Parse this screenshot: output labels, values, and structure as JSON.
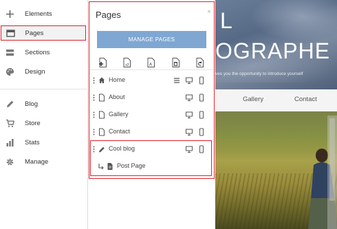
{
  "sidebar": {
    "items": [
      {
        "label": "Elements",
        "icon": "plus-icon"
      },
      {
        "label": "Pages",
        "icon": "pages-icon"
      },
      {
        "label": "Sections",
        "icon": "sections-icon"
      },
      {
        "label": "Design",
        "icon": "palette-icon"
      },
      {
        "label": "Blog",
        "icon": "pencil-icon"
      },
      {
        "label": "Store",
        "icon": "cart-icon"
      },
      {
        "label": "Stats",
        "icon": "stats-icon"
      },
      {
        "label": "Manage",
        "icon": "gear-icon"
      }
    ]
  },
  "panel": {
    "title": "Pages",
    "close": "×",
    "manage_button": "MANAGE PAGES",
    "pages": [
      {
        "label": "Home",
        "icon": "home-icon"
      },
      {
        "label": "About",
        "icon": "page-icon"
      },
      {
        "label": "Gallery",
        "icon": "page-icon"
      },
      {
        "label": "Contact",
        "icon": "page-icon"
      },
      {
        "label": "Cool blog",
        "icon": "pencil-icon"
      },
      {
        "label": "Post Page",
        "icon": "post-page-icon"
      }
    ]
  },
  "preview": {
    "hero_letter": "L",
    "hero_title": "OGRAPHE",
    "hero_subtitle": "ves you the opportunity to introduce yourself",
    "nav": [
      "Gallery",
      "Contact"
    ]
  },
  "colors": {
    "accent_red": "#d9232a",
    "button_blue": "#7fa7d1"
  }
}
